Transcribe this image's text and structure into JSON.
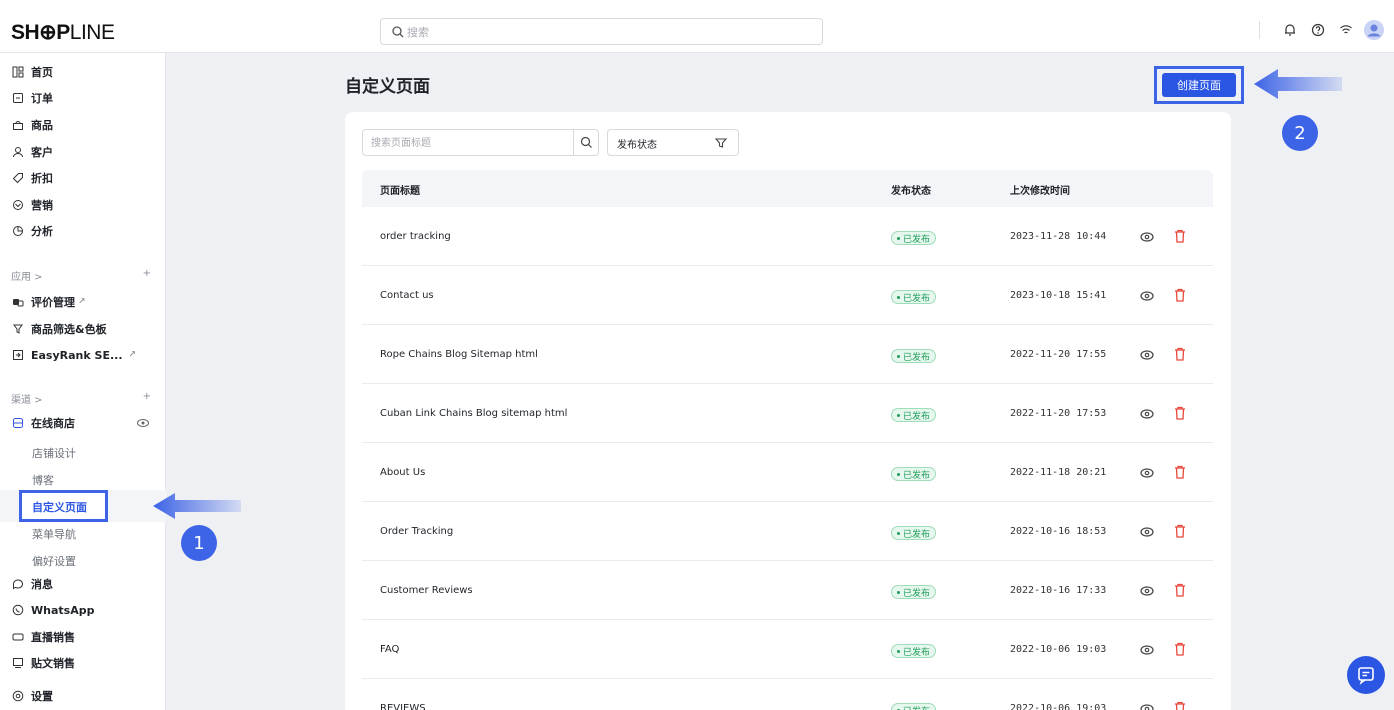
{
  "brand": {
    "logo_bold": "SH⊕P",
    "logo_thin": "LINE"
  },
  "topbar": {
    "search_placeholder": "搜索"
  },
  "sidebar": {
    "main": [
      {
        "label": "首页",
        "icon": "home-icon"
      },
      {
        "label": "订单",
        "icon": "order-icon"
      },
      {
        "label": "商品",
        "icon": "product-icon"
      },
      {
        "label": "客户",
        "icon": "customer-icon"
      },
      {
        "label": "折扣",
        "icon": "discount-icon"
      },
      {
        "label": "营销",
        "icon": "marketing-icon"
      },
      {
        "label": "分析",
        "icon": "analytics-icon"
      }
    ],
    "apps_group": "应用 >",
    "apps": [
      {
        "label": "评价管理",
        "icon": "review-icon",
        "external": true
      },
      {
        "label": "商品筛选&色板",
        "icon": "filter-app-icon",
        "external": false
      },
      {
        "label": "EasyRank SE...",
        "icon": "easyrank-icon",
        "external": true
      }
    ],
    "channels_group": "渠道 >",
    "online_store": "在线商店",
    "store_subs": [
      "店铺设计",
      "博客",
      "自定义页面",
      "菜单导航",
      "偏好设置"
    ],
    "channels": [
      {
        "label": "消息",
        "icon": "message-icon"
      },
      {
        "label": "WhatsApp",
        "icon": "whatsapp-icon"
      },
      {
        "label": "直播销售",
        "icon": "live-icon"
      },
      {
        "label": "贴文销售",
        "icon": "post-sale-icon"
      }
    ],
    "settings": "设置"
  },
  "main": {
    "title": "自定义页面",
    "create_button": "创建页面",
    "search_placeholder": "搜索页面标题",
    "filter_label": "发布状态",
    "columns": {
      "title": "页面标题",
      "status": "发布状态",
      "updated": "上次修改时间"
    },
    "rows": [
      {
        "title": "order tracking",
        "status": "已发布",
        "updated": "2023-11-28 10:44"
      },
      {
        "title": "Contact us",
        "status": "已发布",
        "updated": "2023-10-18 15:41"
      },
      {
        "title": "Rope Chains Blog Sitemap html",
        "status": "已发布",
        "updated": "2022-11-20 17:55"
      },
      {
        "title": "Cuban Link Chains Blog sitemap html",
        "status": "已发布",
        "updated": "2022-11-20 17:53"
      },
      {
        "title": "About Us",
        "status": "已发布",
        "updated": "2022-11-18 20:21"
      },
      {
        "title": "Order Tracking",
        "status": "已发布",
        "updated": "2022-10-16 18:53"
      },
      {
        "title": "Customer Reviews",
        "status": "已发布",
        "updated": "2022-10-16 17:33"
      },
      {
        "title": "FAQ",
        "status": "已发布",
        "updated": "2022-10-06 19:03"
      },
      {
        "title": "REVIEWS",
        "status": "已发布",
        "updated": "2022-10-06 19:03"
      }
    ]
  },
  "annotations": {
    "step1": "1",
    "step2": "2"
  },
  "colors": {
    "accent": "#2b56e4",
    "annotation": "#3d63e6",
    "published": "#1e9e5a",
    "delete": "#e8473b"
  }
}
